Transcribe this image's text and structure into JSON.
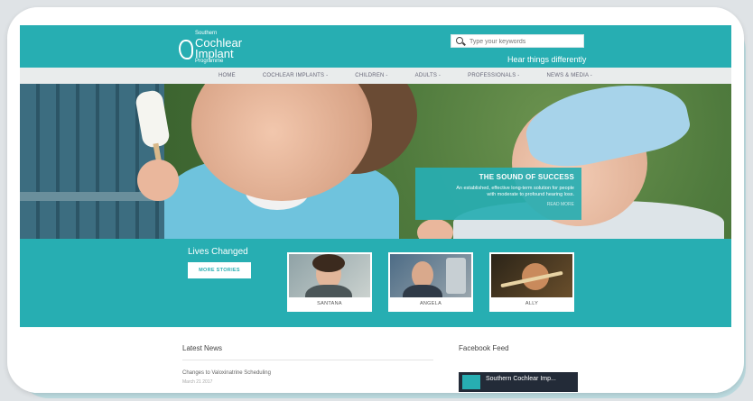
{
  "header": {
    "logo_small_top": "Southern",
    "logo_line1": "Cochlear",
    "logo_line2": "Implant",
    "logo_small_bottom": "Programme",
    "search_placeholder": "Type your keywords",
    "tagline": "Hear things differently"
  },
  "nav": {
    "items": [
      "HOME",
      "COCHLEAR IMPLANTS -",
      "CHILDREN -",
      "ADULTS -",
      "PROFESSIONALS -",
      "NEWS & MEDIA -"
    ]
  },
  "hero": {
    "title": "THE SOUND OF SUCCESS",
    "text1": "An established, effective long-term solution for people",
    "text2": "with moderate to profound hearing loss.",
    "link": "READ MORE",
    "slides": 3,
    "active_slide": 2
  },
  "lives": {
    "title": "Lives Changed",
    "button": "MORE STORIES",
    "stories": [
      {
        "name": "SANTANA"
      },
      {
        "name": "ANGELA"
      },
      {
        "name": "ALLY"
      }
    ]
  },
  "news": {
    "title": "Latest News",
    "item_title": "Changes to Valoxinatrine Scheduling",
    "item_date": "March 21 2017"
  },
  "facebook": {
    "title": "Facebook Feed",
    "page_name": "Southern Cochlear Imp..."
  },
  "colors": {
    "brand": "#27aeb2",
    "nav_bg": "#e9ecec"
  }
}
